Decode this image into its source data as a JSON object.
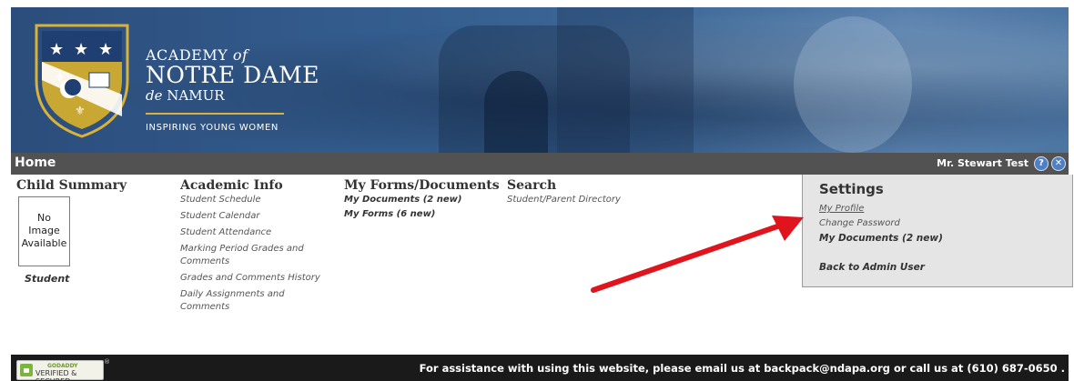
{
  "header": {
    "school_line1": "ACADEMY",
    "school_line1_of": "of",
    "school_line2": "NOTRE DAME",
    "school_line3_de": "de",
    "school_line3": "NAMUR",
    "tagline": "INSPIRING YOUNG WOMEN"
  },
  "homebar": {
    "title": "Home",
    "user_name": "Mr. Stewart Test",
    "help_icon": "help-icon",
    "close_icon": "close-icon"
  },
  "child_summary": {
    "title": "Child Summary",
    "photo_placeholder": [
      "No",
      "Image",
      "Available"
    ],
    "student_label": "Student"
  },
  "academic_info": {
    "title": "Academic Info",
    "links": [
      "Student Schedule",
      "Student Calendar",
      "Student Attendance",
      "Marking Period Grades and Comments",
      "Grades and Comments History",
      "Daily Assignments and Comments"
    ]
  },
  "forms_documents": {
    "title": "My Forms/Documents",
    "links": [
      "My Documents (2 new)",
      "My Forms (6 new)"
    ]
  },
  "search": {
    "title": "Search",
    "links": [
      "Student/Parent Directory"
    ]
  },
  "settings": {
    "title": "Settings",
    "links": [
      "My Profile",
      "Change Password",
      "My Documents (2 new)",
      "Back to Admin User"
    ]
  },
  "footer": {
    "message": "For assistance with using this website, please email us at backpack@ndapa.org or call us at (610) 687-0650 .",
    "badge_top": "GODADDY",
    "badge_text": "VERIFIED & SECURED"
  },
  "colors": {
    "banner_blue": "#345d8e",
    "home_bar": "#525252",
    "settings_bg": "#e5e5e5",
    "footer": "#1a1a1a",
    "arrow": "#e0141c",
    "crest_gold": "#d8b23a"
  }
}
